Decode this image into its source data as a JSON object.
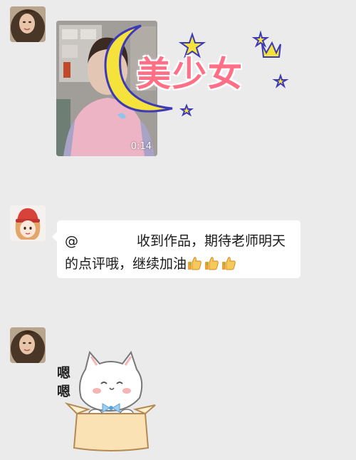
{
  "messages": [
    {
      "type": "video",
      "sender": "avatar-curly-hair",
      "duration": "0:14",
      "sticker_text": "美少女"
    },
    {
      "type": "text",
      "sender": "avatar-red-hat-girl",
      "line1_prefix": "@",
      "line1_suffix": "收到作品，期待老师明天",
      "line2": "的点评哦，继续加油",
      "emoji": [
        "thumbs-up-icon",
        "thumbs-up-icon",
        "thumbs-up-icon"
      ]
    },
    {
      "type": "sticker",
      "sender": "avatar-curly-hair",
      "sticker_text": "嗯嗯"
    }
  ],
  "colors": {
    "background": "#ebebeb",
    "bubble": "#ffffff",
    "sticker_pink": "#ff6f86",
    "moon_yellow": "#f5e23a"
  }
}
